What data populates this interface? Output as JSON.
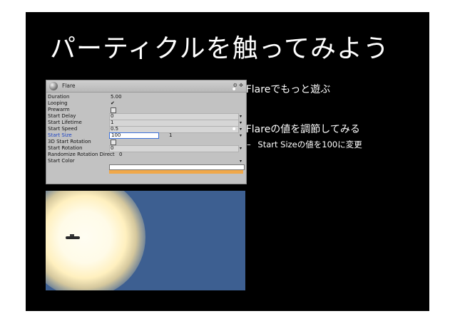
{
  "slide": {
    "title": "パーティクルを触ってみよう",
    "bullets": [
      {
        "marker": "•",
        "text": "Flareでもっと遊ぶ"
      },
      {
        "marker": "•",
        "text": "Flareの値を調節してみる"
      }
    ],
    "sub_bullet": {
      "marker": "–",
      "text": "Start Sizeの値を100に変更"
    }
  },
  "inspector": {
    "component_name": "Flare",
    "header_icons": "⚙ ✥",
    "rows": [
      {
        "label": "Duration",
        "value": "5.00"
      },
      {
        "label": "Looping",
        "value": "✔"
      },
      {
        "label": "Prewarm",
        "value": ""
      },
      {
        "label": "Start Delay",
        "value": "0"
      },
      {
        "label": "Start Lifetime",
        "value": "1"
      },
      {
        "label": "Start Speed",
        "value": "0.5"
      },
      {
        "label": "Start Size",
        "value": "100",
        "value2": "1"
      },
      {
        "label": "3D Start Rotation",
        "value": ""
      },
      {
        "label": "Start Rotation",
        "value": "0"
      },
      {
        "label": "Randomize Rotation Direct",
        "value": "0"
      },
      {
        "label": "Start Color",
        "value": ""
      }
    ],
    "colors": {
      "start_color_top": "#ffffff",
      "start_color_bottom": "#f0a84a"
    }
  },
  "game_view": {
    "background_color": "#3d5f91",
    "glow_color": "#fff6d6"
  }
}
